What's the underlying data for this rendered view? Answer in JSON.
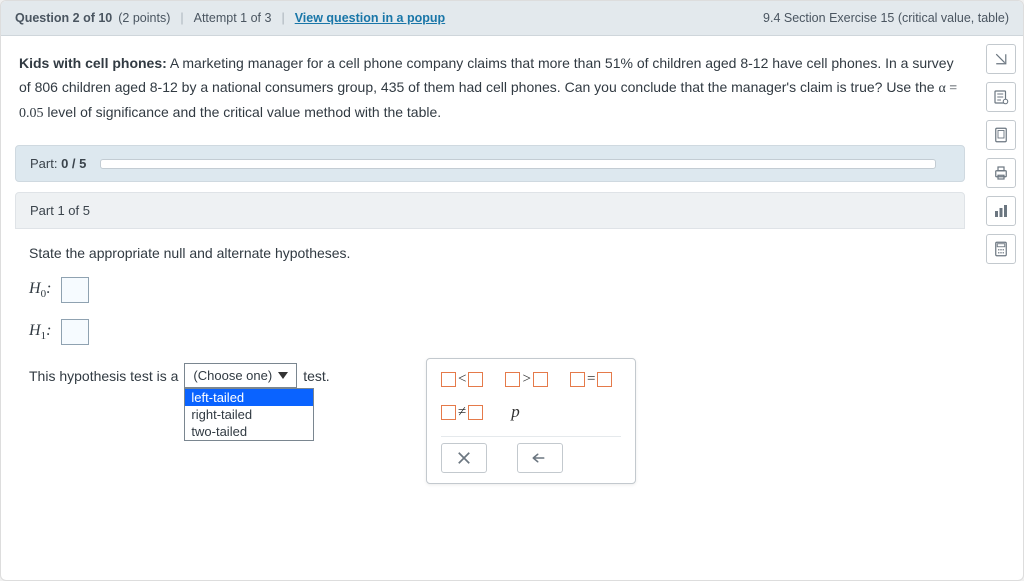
{
  "header": {
    "question_label": "Question 2 of 10",
    "points": "(2 points)",
    "attempt": "Attempt 1 of 3",
    "popup_link": "View question in a popup",
    "exercise_ref": "9.4 Section Exercise 15 (critical value, table)"
  },
  "problem": {
    "title": "Kids with cell phones:",
    "body_before_alpha": " A marketing manager for a cell phone company claims that more than 51% of children aged 8-12 have cell phones. In a survey of 806 children aged 8-12 by a national consumers group, 435 of them had cell phones. Can you conclude that the manager's claim is true? Use the ",
    "alpha_expr": "α = 0.05",
    "body_after_alpha": " level of significance and the critical value method with the table."
  },
  "part_progress": {
    "label_pre": "Part: ",
    "value": "0 / 5"
  },
  "part_header": "Part 1 of 5",
  "part_body": {
    "prompt": "State the appropriate null and alternate hypotheses.",
    "h0_label": "H",
    "h0_sub": "0",
    "h1_label": "H",
    "h1_sub": "1",
    "test_sentence_pre": "This hypothesis test is a",
    "test_sentence_post": " test.",
    "dropdown_placeholder": "(Choose one)",
    "dropdown_options": [
      "left-tailed",
      "right-tailed",
      "two-tailed"
    ],
    "dropdown_selected_index": 0
  },
  "palette": {
    "symbol_lt": "<",
    "symbol_gt": ">",
    "symbol_eq": "=",
    "symbol_ne": "≠",
    "symbol_p": "p"
  },
  "rail": {
    "icons": [
      "skip-icon",
      "notes-icon",
      "ebook-icon",
      "print-icon",
      "stats-icon",
      "calculator-icon"
    ]
  }
}
